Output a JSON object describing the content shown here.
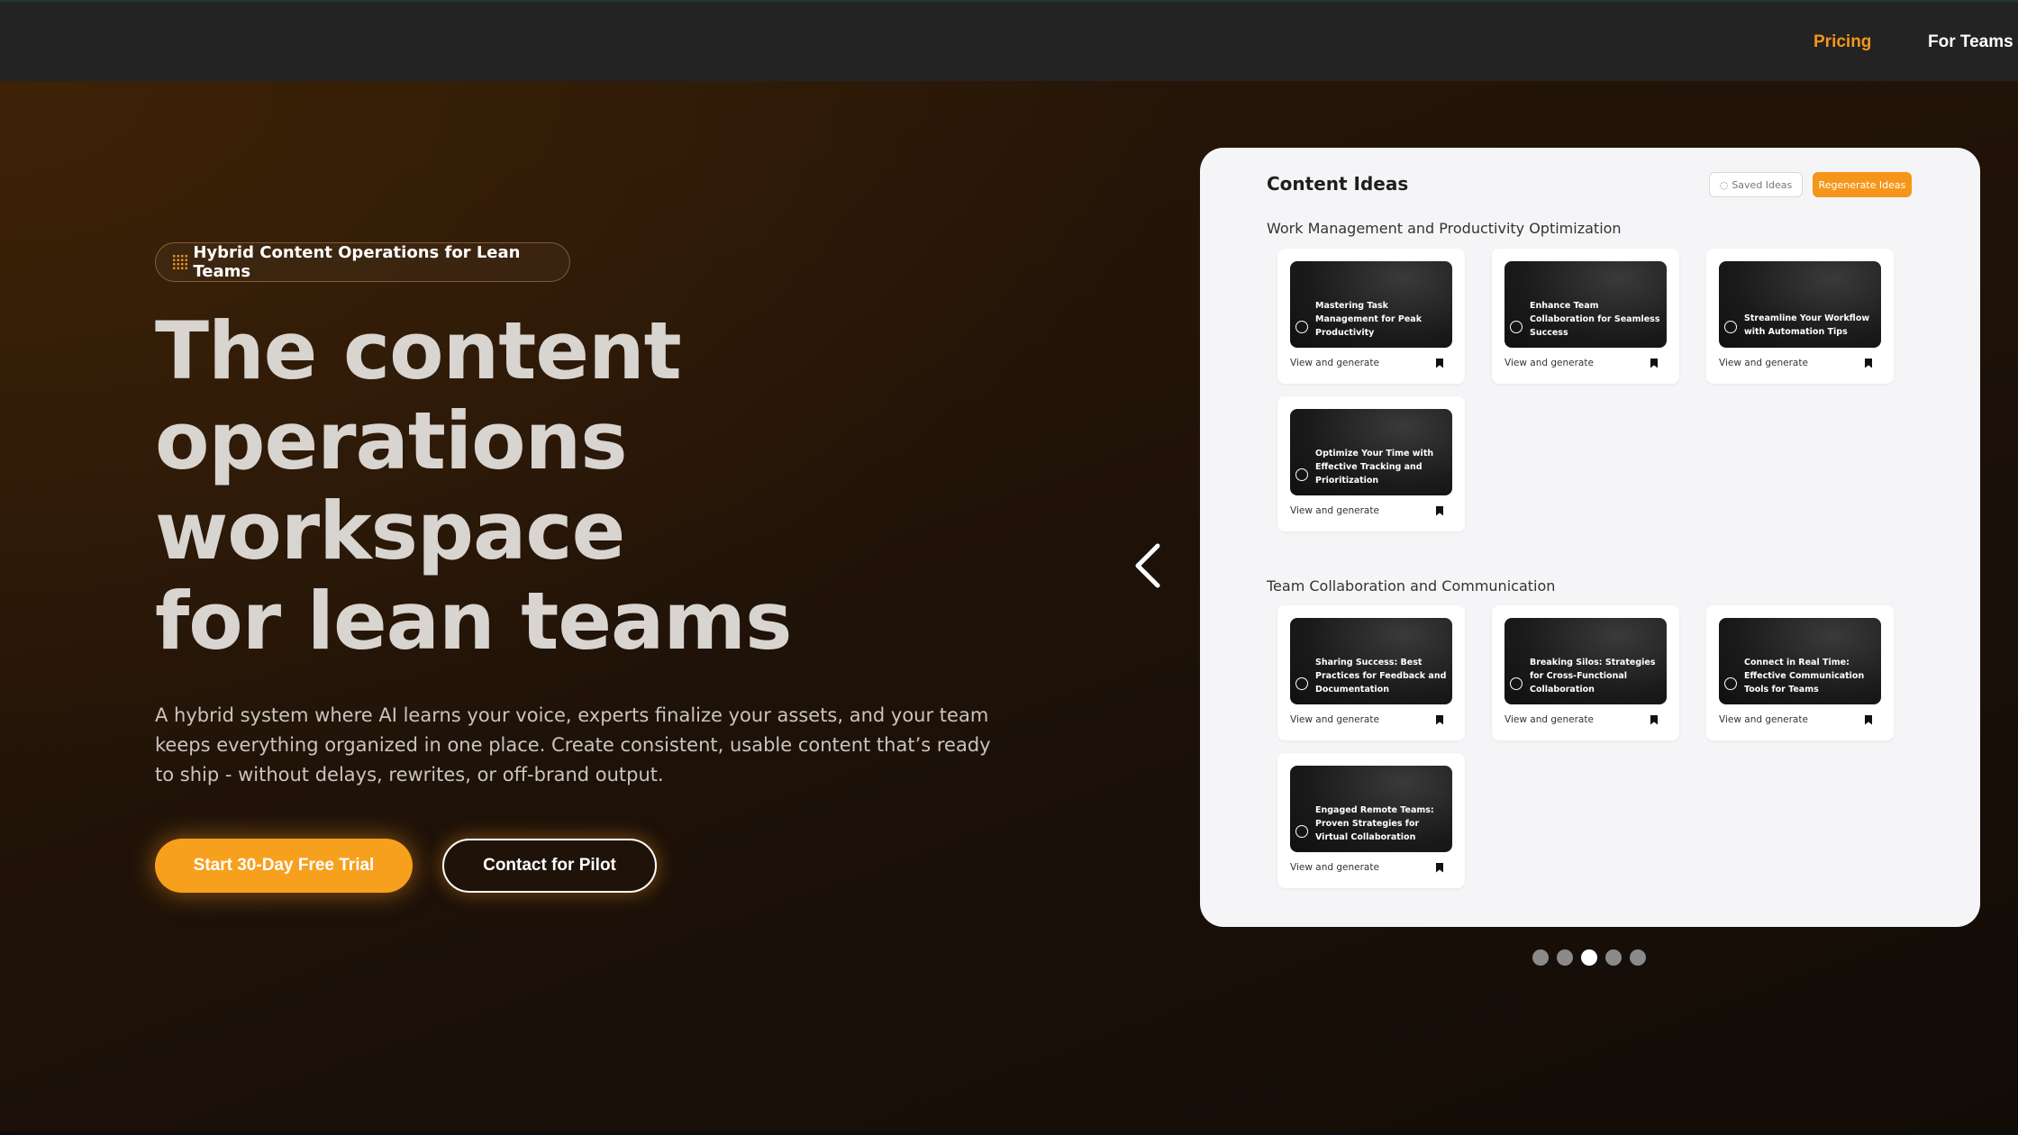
{
  "nav": {
    "pricing": "Pricing",
    "for_teams": "For Teams"
  },
  "hero": {
    "badge": "Hybrid Content Operations for Lean Teams",
    "headline": [
      "The content",
      "operations",
      "workspace",
      "for lean teams"
    ],
    "subtext": "A hybrid system where AI learns your voice, experts finalize your assets, and your team keeps everything organized in one place. Create consistent, usable content that’s ready to ship - without delays, rewrites, or off-brand output.",
    "primary_cta": "Start 30-Day Free Trial",
    "secondary_cta": "Contact for Pilot"
  },
  "panel": {
    "title": "Content Ideas",
    "saved_ideas": "Saved Ideas",
    "regenerate": "Regenerate Ideas",
    "sections": [
      {
        "title": "Work Management and Productivity Optimization",
        "cards": [
          {
            "title": "Mastering Task Management for Peak Productivity",
            "action": "View and generate"
          },
          {
            "title": "Enhance Team Collaboration for Seamless Success",
            "action": "View and generate"
          },
          {
            "title": "Streamline Your Workflow with Automation Tips",
            "action": "View and generate"
          },
          {
            "title": "Optimize Your Time with Effective Tracking and Prioritization",
            "action": "View and generate"
          }
        ]
      },
      {
        "title": "Team Collaboration and Communication",
        "cards": [
          {
            "title": "Sharing Success: Best Practices for Feedback and Documentation",
            "action": "View and generate"
          },
          {
            "title": "Breaking Silos: Strategies for Cross-Functional Collaboration",
            "action": "View and generate"
          },
          {
            "title": "Connect in Real Time: Effective Communication Tools for Teams",
            "action": "View and generate"
          },
          {
            "title": "Engaged Remote Teams: Proven Strategies for Virtual Collaboration",
            "action": "View and generate"
          }
        ]
      }
    ]
  },
  "carousel": {
    "slide_count": 5,
    "active_index": 2
  },
  "colors": {
    "accent": "#f5961b",
    "topbar": "#232323"
  }
}
